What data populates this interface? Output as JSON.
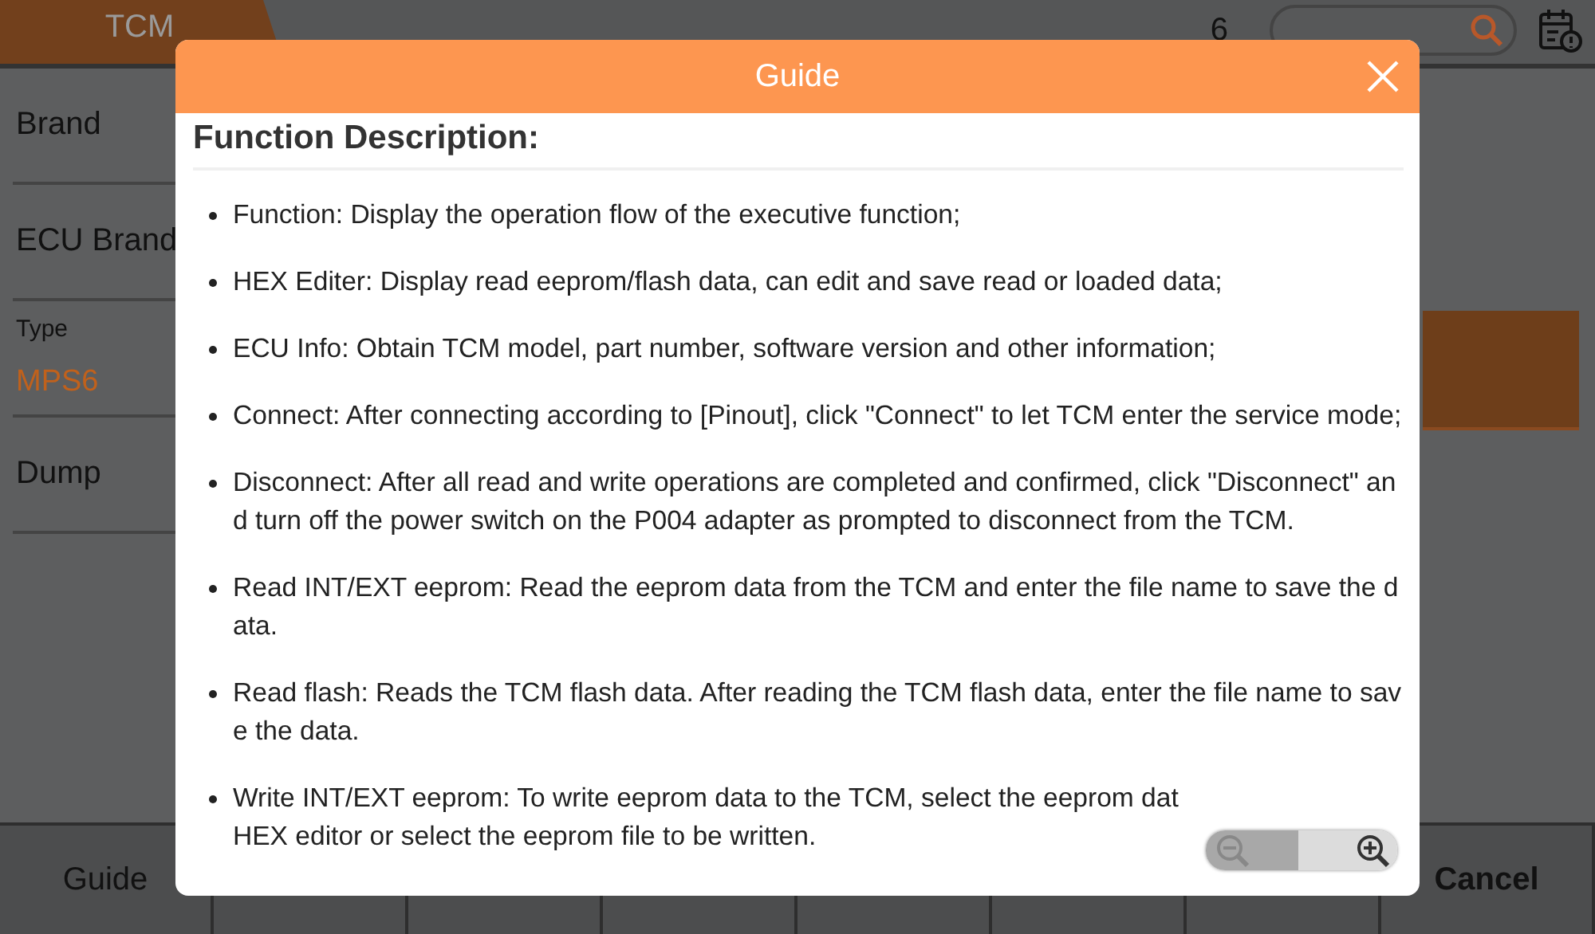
{
  "top_bar": {
    "tab": {
      "label": "TCM",
      "selected": true
    },
    "count": "6"
  },
  "left_panel": {
    "items": [
      {
        "kind": "label",
        "label": "Brand"
      },
      {
        "kind": "label",
        "label": "ECU Brand"
      },
      {
        "kind": "value",
        "label": "Type",
        "value": "MPS6"
      },
      {
        "kind": "label",
        "label": "Dump"
      }
    ]
  },
  "dialog": {
    "title": "Guide",
    "heading": "Function Description:",
    "items": [
      {
        "text": "Function: Display the operation flow of the executive function;"
      },
      {
        "text": "HEX Editer: Display read eeprom/flash data, can edit and save read or loaded data;"
      },
      {
        "text": "ECU Info: Obtain TCM model, part number, software version and other information;"
      },
      {
        "text": "Connect: After connecting according to [Pinout], click \"Connect\" to let TCM enter the service mode;"
      },
      {
        "text": "Disconnect: After all read and write operations are completed and confirmed, click \"Disconnect\" and turn off the power switch on the P004 adapter as prompted to disconnect from the TCM."
      },
      {
        "text": "Read INT/EXT eeprom: Read the eeprom data from the TCM and enter the file name to save the data."
      },
      {
        "text": "Read flash: Reads the TCM flash data. After reading the TCM flash data, enter the file name to save the data."
      },
      {
        "text": "Write INT/EXT eeprom: To write eeprom data to the TCM, select the eeprom dat",
        "continuation": "HEX editor or select the eeprom file to be written."
      }
    ]
  },
  "bottom_bar": {
    "buttons": [
      {
        "label": "Guide",
        "emphasized": false
      },
      {
        "label": "Cancel",
        "emphasized": true
      }
    ]
  }
}
